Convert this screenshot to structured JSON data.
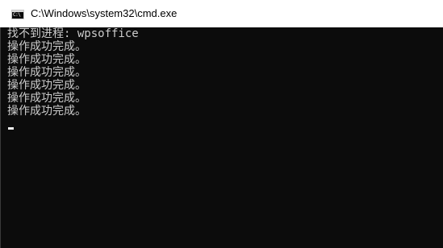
{
  "window": {
    "title": "C:\\Windows\\system32\\cmd.exe",
    "icon": "cmd-console-icon",
    "icon_glyph": "C:\\"
  },
  "console": {
    "lines": [
      "找不到进程: wpsoffice",
      "操作成功完成。",
      "操作成功完成。",
      "操作成功完成。",
      "操作成功完成。",
      "操作成功完成。",
      "操作成功完成。"
    ],
    "background_color": "#0c0c0c",
    "text_color": "#cccccc"
  }
}
